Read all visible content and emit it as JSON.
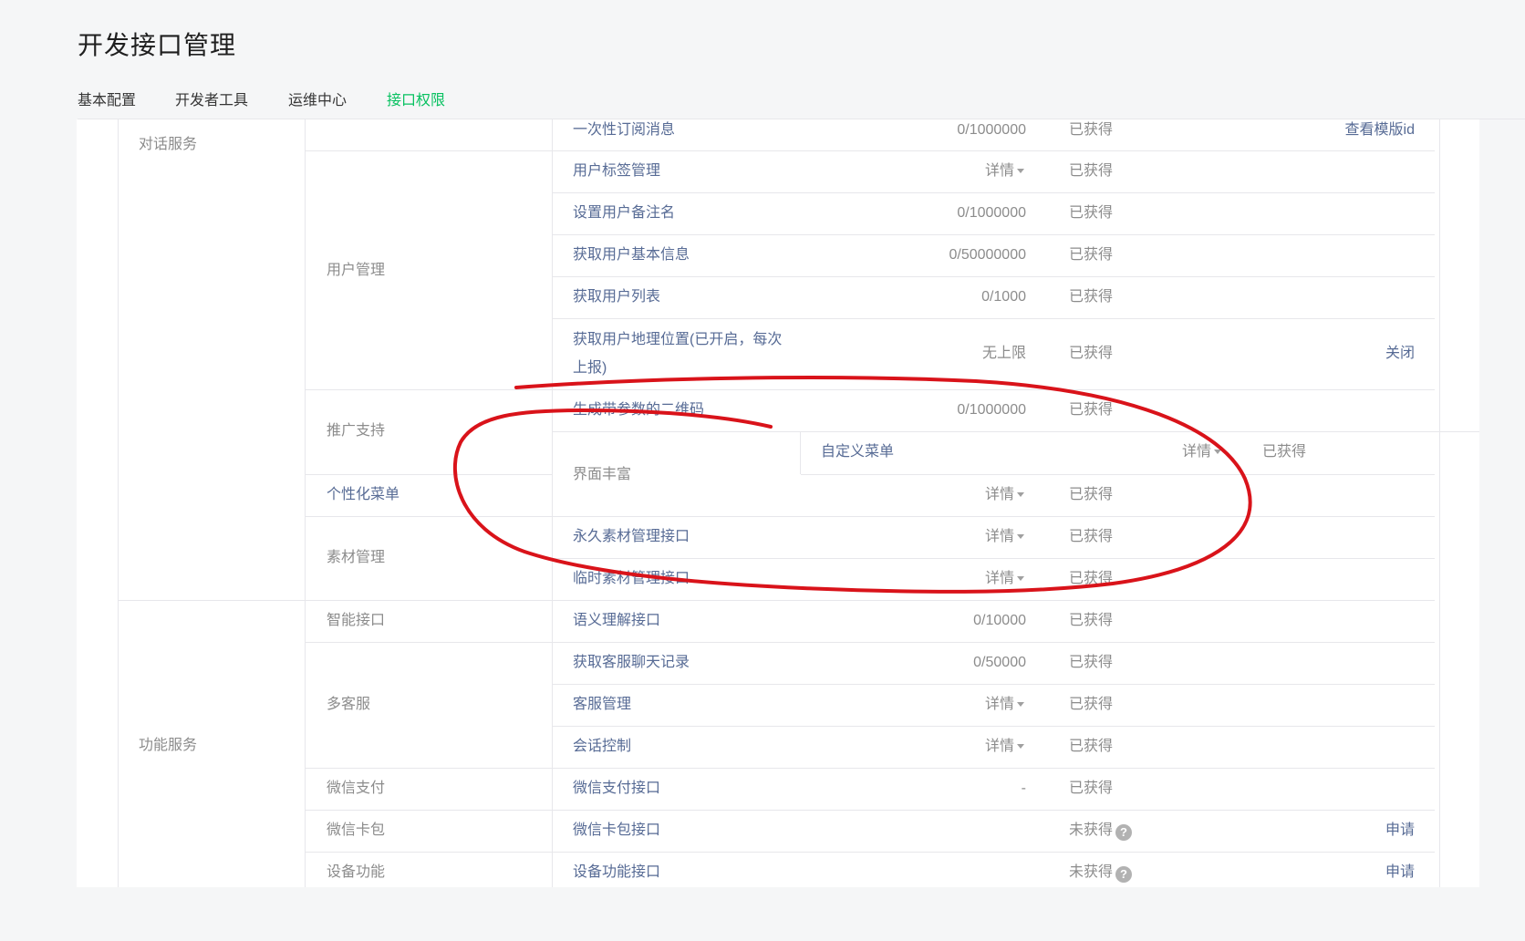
{
  "page": {
    "title": "开发接口管理"
  },
  "tabs": [
    {
      "label": "基本配置",
      "active": false
    },
    {
      "label": "开发者工具",
      "active": false
    },
    {
      "label": "运维中心",
      "active": false
    },
    {
      "label": "接口权限",
      "active": true
    }
  ],
  "categories": {
    "dialog": "对话服务",
    "function": "功能服务"
  },
  "groups": {
    "user_mgmt": "用户管理",
    "promo": "推广支持",
    "ui_rich": "界面丰富",
    "custom_menu_group": "个性化菜单",
    "material": "素材管理",
    "smart": "智能接口",
    "multi_cs": "多客服",
    "wxpay": "微信支付",
    "wxcard": "微信卡包",
    "device": "设备功能"
  },
  "rows": {
    "r0": {
      "name": "一次性订阅消息",
      "quota": "0/1000000",
      "status": "已获得",
      "action": "查看模版id"
    },
    "r1": {
      "name": "用户标签管理",
      "detail": "详情",
      "status": "已获得"
    },
    "r2": {
      "name": "设置用户备注名",
      "quota": "0/1000000",
      "status": "已获得"
    },
    "r3": {
      "name": "获取用户基本信息",
      "quota": "0/50000000",
      "status": "已获得"
    },
    "r4": {
      "name": "获取用户列表",
      "quota": "0/1000",
      "status": "已获得"
    },
    "r5": {
      "name": "获取用户地理位置(已开启，每次上报)",
      "quota": "无上限",
      "status": "已获得",
      "action": "关闭"
    },
    "r6": {
      "name": "生成带参数的二维码",
      "quota": "0/1000000",
      "status": "已获得"
    },
    "r7": {
      "name": "自定义菜单",
      "detail": "详情",
      "status": "已获得"
    },
    "r8": {
      "detail": "详情",
      "status": "已获得"
    },
    "r9": {
      "name": "永久素材管理接口",
      "detail": "详情",
      "status": "已获得"
    },
    "r10": {
      "name": "临时素材管理接口",
      "detail": "详情",
      "status": "已获得"
    },
    "r11": {
      "name": "语义理解接口",
      "quota": "0/10000",
      "status": "已获得"
    },
    "r12": {
      "name": "获取客服聊天记录",
      "quota": "0/50000",
      "status": "已获得"
    },
    "r13": {
      "name": "客服管理",
      "detail": "详情",
      "status": "已获得"
    },
    "r14": {
      "name": "会话控制",
      "detail": "详情",
      "status": "已获得"
    },
    "r15": {
      "name": "微信支付接口",
      "quota": "-",
      "status": "已获得"
    },
    "r16": {
      "name": "微信卡包接口",
      "status": "未获得",
      "help": "?",
      "action": "申请"
    },
    "r17": {
      "name": "设备功能接口",
      "status": "未获得",
      "help": "?",
      "action": "申请"
    }
  },
  "colors": {
    "accent": "#07c160",
    "link": "#576b95",
    "muted": "#8c8c8c",
    "annotation_red": "#d9131a"
  }
}
